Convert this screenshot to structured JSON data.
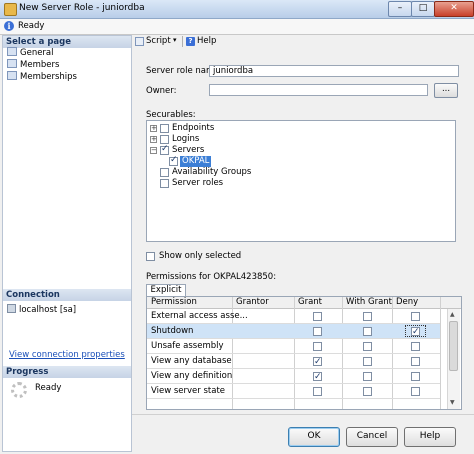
{
  "window": {
    "title": "New Server Role - juniordba",
    "controls": [
      "–",
      "□",
      "✕"
    ]
  },
  "status": {
    "text": "Ready"
  },
  "left": {
    "select_page_header": "Select a page",
    "pages": [
      "General",
      "Members",
      "Memberships"
    ],
    "connection_header": "Connection",
    "connection_value": "localhost [sa]",
    "view_connection_link": "View connection properties",
    "progress_header": "Progress",
    "progress_status": "Ready"
  },
  "toolbar": {
    "script_label": "Script",
    "help_label": "Help"
  },
  "form": {
    "server_role_name_label": "Server role name:",
    "server_role_name_value": "juniordba",
    "owner_label": "Owner:",
    "owner_value": "",
    "browse_label": "...",
    "securables_label": "Securables:",
    "tree": [
      {
        "label": "Endpoints",
        "expander": "+",
        "checked": false
      },
      {
        "label": "Logins",
        "expander": "+",
        "checked": false
      },
      {
        "label": "Servers",
        "expander": "−",
        "checked": true
      },
      {
        "label": "OKPAL",
        "expander": "",
        "checked": true,
        "selected": true
      },
      {
        "label": "Availability Groups",
        "expander": "",
        "checked": false
      },
      {
        "label": "Server roles",
        "expander": "",
        "checked": false
      }
    ],
    "show_only_selected_label": "Show only selected",
    "permissions_label": "Permissions for OKPAL423850:",
    "tab_explicit": "Explicit"
  },
  "permissions_grid": {
    "columns": [
      "Permission",
      "Grantor",
      "Grant",
      "With Grant",
      "Deny"
    ],
    "rows": [
      {
        "permission": "External access asse...",
        "grantor": "",
        "grant": false,
        "with_grant": false,
        "deny": false
      },
      {
        "permission": "Shutdown",
        "grantor": "",
        "grant": false,
        "with_grant": false,
        "deny": true,
        "selected": true
      },
      {
        "permission": "Unsafe assembly",
        "grantor": "",
        "grant": false,
        "with_grant": false,
        "deny": false
      },
      {
        "permission": "View any database",
        "grantor": "",
        "grant": true,
        "with_grant": false,
        "deny": false
      },
      {
        "permission": "View any definition",
        "grantor": "",
        "grant": true,
        "with_grant": false,
        "deny": false
      },
      {
        "permission": "View server state",
        "grantor": "",
        "grant": false,
        "with_grant": false,
        "deny": false
      }
    ]
  },
  "buttons": {
    "ok": "OK",
    "cancel": "Cancel",
    "help": "Help"
  }
}
